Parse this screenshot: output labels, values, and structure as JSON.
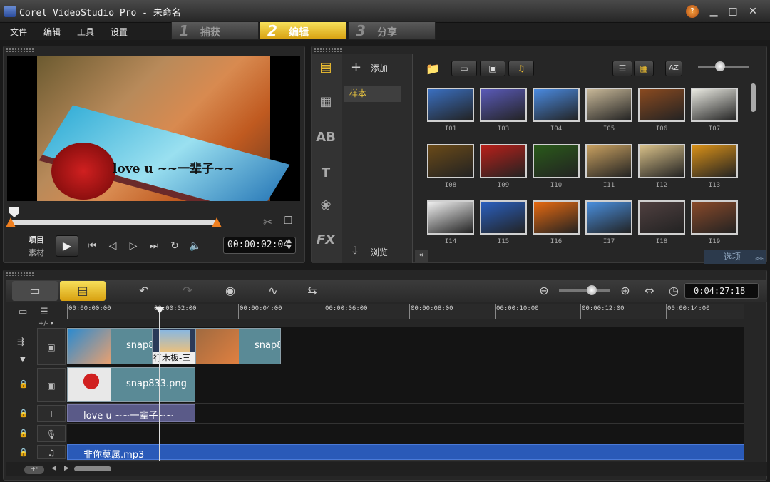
{
  "window": {
    "title": "Corel VideoStudio Pro - 未命名",
    "controls": [
      "minimize-icon",
      "maximize-icon",
      "close-icon"
    ]
  },
  "menu": [
    "文件",
    "编辑",
    "工具",
    "设置"
  ],
  "steps": [
    {
      "num": "1",
      "label": "捕获",
      "active": false
    },
    {
      "num": "2",
      "label": "编辑",
      "active": true
    },
    {
      "num": "3",
      "label": "分享",
      "active": false
    }
  ],
  "preview": {
    "caption": "love u ~~一辈子~~",
    "mode_project": "项目",
    "mode_clip": "素材",
    "timecode": "00:00:02:04"
  },
  "library": {
    "add_label": "添加",
    "browse_label": "浏览",
    "folder": "样本",
    "options_label": "选项",
    "thumbnails": [
      {
        "label": "I01",
        "color": "#3a6fc0"
      },
      {
        "label": "I03",
        "color": "#5a5ab8"
      },
      {
        "label": "I04",
        "color": "#4a8ae0"
      },
      {
        "label": "I05",
        "color": "#c8b898"
      },
      {
        "label": "I06",
        "color": "#8a4a20"
      },
      {
        "label": "I07",
        "color": "#e8e8e0"
      },
      {
        "label": "I08",
        "color": "#6a4a18"
      },
      {
        "label": "I09",
        "color": "#b8201a"
      },
      {
        "label": "I10",
        "color": "#2a5a1a"
      },
      {
        "label": "I11",
        "color": "#c8a060"
      },
      {
        "label": "I12",
        "color": "#d8c088"
      },
      {
        "label": "I13",
        "color": "#d89018"
      },
      {
        "label": "I14",
        "color": "#f0f0f0"
      },
      {
        "label": "I15",
        "color": "#2a60c0"
      },
      {
        "label": "I16",
        "color": "#e86a10"
      },
      {
        "label": "I17",
        "color": "#4a90e0"
      },
      {
        "label": "I18",
        "color": "#504040"
      },
      {
        "label": "I19",
        "color": "#8a4a2a"
      }
    ]
  },
  "timeline": {
    "timecode": "0:04:27:18",
    "ruler": [
      "00:00:00:00",
      "00:00:02:00",
      "00:00:04:00",
      "00:00:06:00",
      "00:00:08:00",
      "00:00:10:00",
      "00:00:12:00",
      "00:00:14:00"
    ],
    "video_clips": [
      "snap8",
      "行木板-三",
      "snap8"
    ],
    "overlay_clip": "snap833.png",
    "title_clip": "love u ~~一辈子~~",
    "music_clip": "非你莫属.mp3"
  }
}
